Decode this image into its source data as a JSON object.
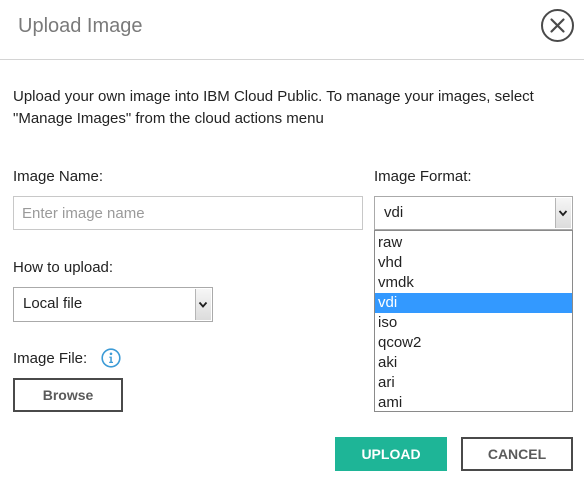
{
  "dialog": {
    "title": "Upload Image",
    "close_icon": "close-circle-icon",
    "description": "Upload your own image into IBM Cloud Public. To manage your images, select \"Manage Images\" from the cloud actions menu"
  },
  "form": {
    "image_name_label": "Image Name:",
    "image_name_placeholder": "Enter image name",
    "image_name_value": "",
    "image_format_label": "Image Format:",
    "image_format_selected": "vdi",
    "image_format_options": [
      "raw",
      "vhd",
      "vmdk",
      "vdi",
      "iso",
      "qcow2",
      "aki",
      "ari",
      "ami"
    ],
    "how_to_upload_label": "How to upload:",
    "how_to_upload_selected": "Local file",
    "image_file_label": "Image File:",
    "info_icon": "info-icon",
    "browse_label": "Browse"
  },
  "footer": {
    "upload_label": "UPLOAD",
    "cancel_label": "CANCEL"
  },
  "colors": {
    "accent": "#1eb597",
    "selection": "#3399ff",
    "info": "#3c9bd6"
  }
}
